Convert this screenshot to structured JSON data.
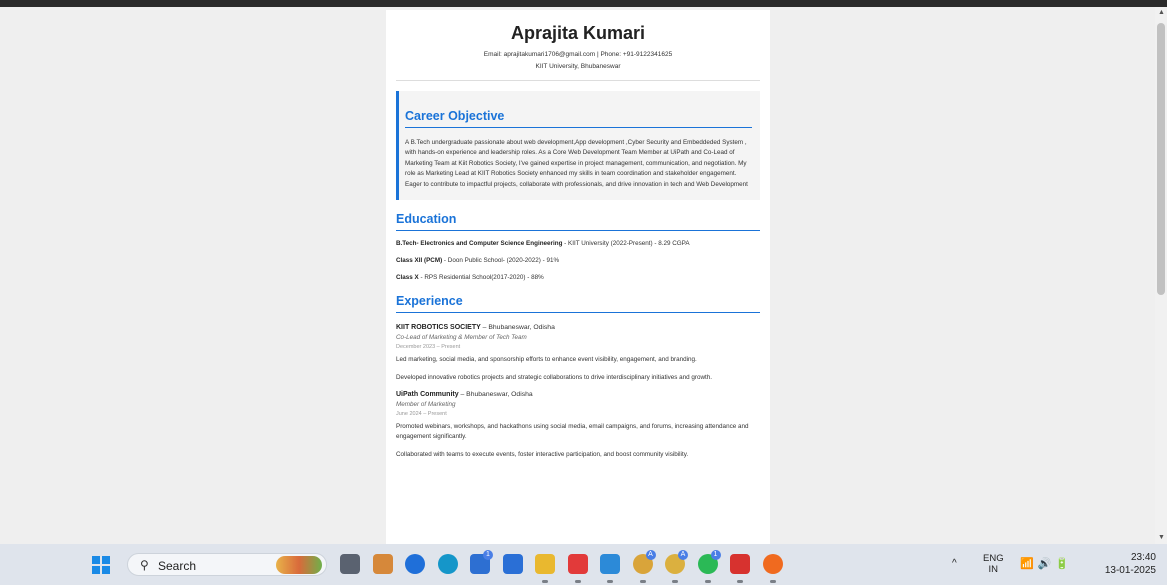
{
  "resume": {
    "name": "Aprajita Kumari",
    "contact": "Email: aprajitakumari1706@gmail.com | Phone: +91-9122341625",
    "location": "KIIT University, Bhubaneswar",
    "objective": {
      "title": "Career Objective",
      "text": "A B.Tech undergraduate passionate about web development,App development ,Cyber Security and Embeddeded System , with hands-on experience and leadership roles. As a Core Web Development Team Member at UiPath and Co-Lead of Marketing Team at Kiit Robotics Society, I've gained expertise in project management, communication, and negotiation. My role as Marketing Lead at KIIT Robotics Society enhanced my skills in team coordination and stakeholder engagement. Eager to contribute to impactful projects, collaborate with professionals, and drive innovation in tech and Web Development"
    },
    "education": {
      "title": "Education",
      "items": [
        {
          "degree": "B.Tech- Electronics and Computer Science Engineering",
          "detail": " - KIIT University (2022-Present) - 8.29 CGPA"
        },
        {
          "degree": "Class XII (PCM)",
          "detail": " - Doon Public School- (2020-2022) - 91%"
        },
        {
          "degree": "Class X",
          "detail": " - RPS Residential School(2017-2020) - 88%"
        }
      ]
    },
    "experience": {
      "title": "Experience",
      "items": [
        {
          "org": "KIIT ROBOTICS SOCIETY",
          "location": " – Bhubaneswar, Odisha",
          "role": "Co-Lead of Marketing & Member of Tech Team",
          "date": "December 2023 – Present",
          "points": [
            "Led marketing, social media, and sponsorship efforts to enhance event visibility, engagement, and branding.",
            "Developed innovative robotics projects and strategic collaborations to drive interdisciplinary initiatives and growth."
          ]
        },
        {
          "org": "UiPath Community",
          "location": " – Bhubaneswar, Odisha",
          "role": "Member of Marketing",
          "date": "June 2024 – Present",
          "points": [
            "Promoted webinars, workshops, and hackathons using social media, email campaigns, and forums, increasing attendance and engagement significantly.",
            "Collaborated with teams to execute events, foster interactive participation, and boost community visibility."
          ]
        }
      ]
    }
  },
  "taskbar": {
    "search_label": "Search",
    "search_icon": "search-icon",
    "lang_line1": "ENG",
    "lang_line2": "IN",
    "time": "23:40",
    "date": "13-01-2025",
    "tray_chevron": "^",
    "sys_icons": "wifi volume battery",
    "apps": [
      {
        "name": "task-view-icon",
        "color": "#5a6270"
      },
      {
        "name": "copilot-icon",
        "color": "#d6883a"
      },
      {
        "name": "opera-icon",
        "color": "#1f6fd9"
      },
      {
        "name": "edge-icon",
        "color": "#1596c9"
      },
      {
        "name": "linkedin-icon",
        "color": "#2d6fd2"
      },
      {
        "name": "microsoft-store-icon",
        "color": "#2a6fd6"
      },
      {
        "name": "file-explorer-icon",
        "color": "#e9b82f"
      },
      {
        "name": "wps-office-icon",
        "color": "#e23a3a"
      },
      {
        "name": "vscode-icon",
        "color": "#2c8ad8"
      },
      {
        "name": "chrome-icon",
        "color": "#d9a43a"
      },
      {
        "name": "chrome-profile-icon",
        "color": "#dbb03f"
      },
      {
        "name": "whatsapp-icon",
        "color": "#2bb956"
      },
      {
        "name": "acrobat-icon",
        "color": "#d7322f"
      },
      {
        "name": "soundcloud-icon",
        "color": "#f06a1f"
      }
    ],
    "badges": {
      "linkedin": "1",
      "chrome": "A",
      "chrome_profile": "A",
      "whatsapp": "1"
    }
  }
}
